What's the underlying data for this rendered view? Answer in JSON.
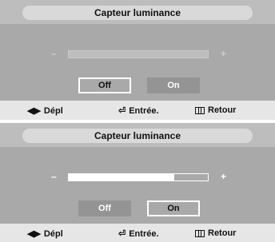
{
  "screens": [
    {
      "title": "Capteur luminance",
      "minus": "–",
      "plus": "+",
      "slider_level": 0.0,
      "state": "inactive",
      "buttons": {
        "off": "Off",
        "on": "On",
        "selected": "off"
      },
      "footer": {
        "move": "Dépl",
        "enter": "Entrée.",
        "return": "Retour"
      }
    },
    {
      "title": "Capteur luminance",
      "minus": "–",
      "plus": "+",
      "slider_level": 0.76,
      "state": "active",
      "buttons": {
        "off": "Off",
        "on": "On",
        "selected": "on"
      },
      "footer": {
        "move": "Dépl",
        "enter": "Entrée.",
        "return": "Retour"
      }
    }
  ],
  "icons": {
    "move": "left-right-arrows-icon",
    "enter": "enter-icon",
    "return": "menu-return-icon"
  }
}
